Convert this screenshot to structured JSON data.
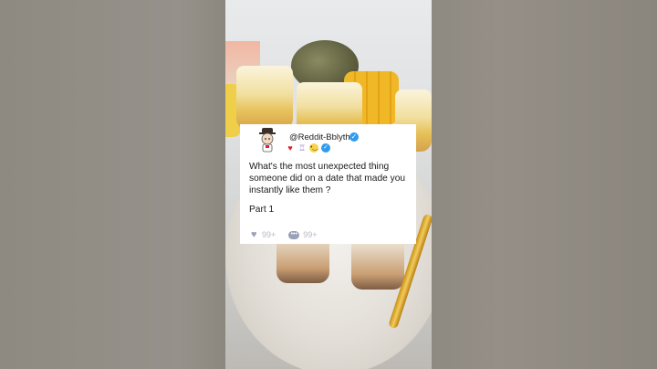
{
  "post": {
    "handle": "@Reddit-Bblythe",
    "question": "What's the most unexpected thing someone did on a date that made you instantly like them ?",
    "part": "Part 1",
    "likes": "99+",
    "comments": "99+"
  },
  "icons": {
    "avatar": "cartoon-avatar-icon",
    "verified": "verified-check-icon",
    "badges": [
      "heart-icon",
      "trophy-icon",
      "smiley-icon",
      "check-badge-icon"
    ],
    "like": "heart-icon",
    "comment": "speech-bubble-icon"
  },
  "colors": {
    "verified": "#2f9bf0",
    "heart": "#e0202e",
    "stat_icons": "#9aa0b5"
  }
}
